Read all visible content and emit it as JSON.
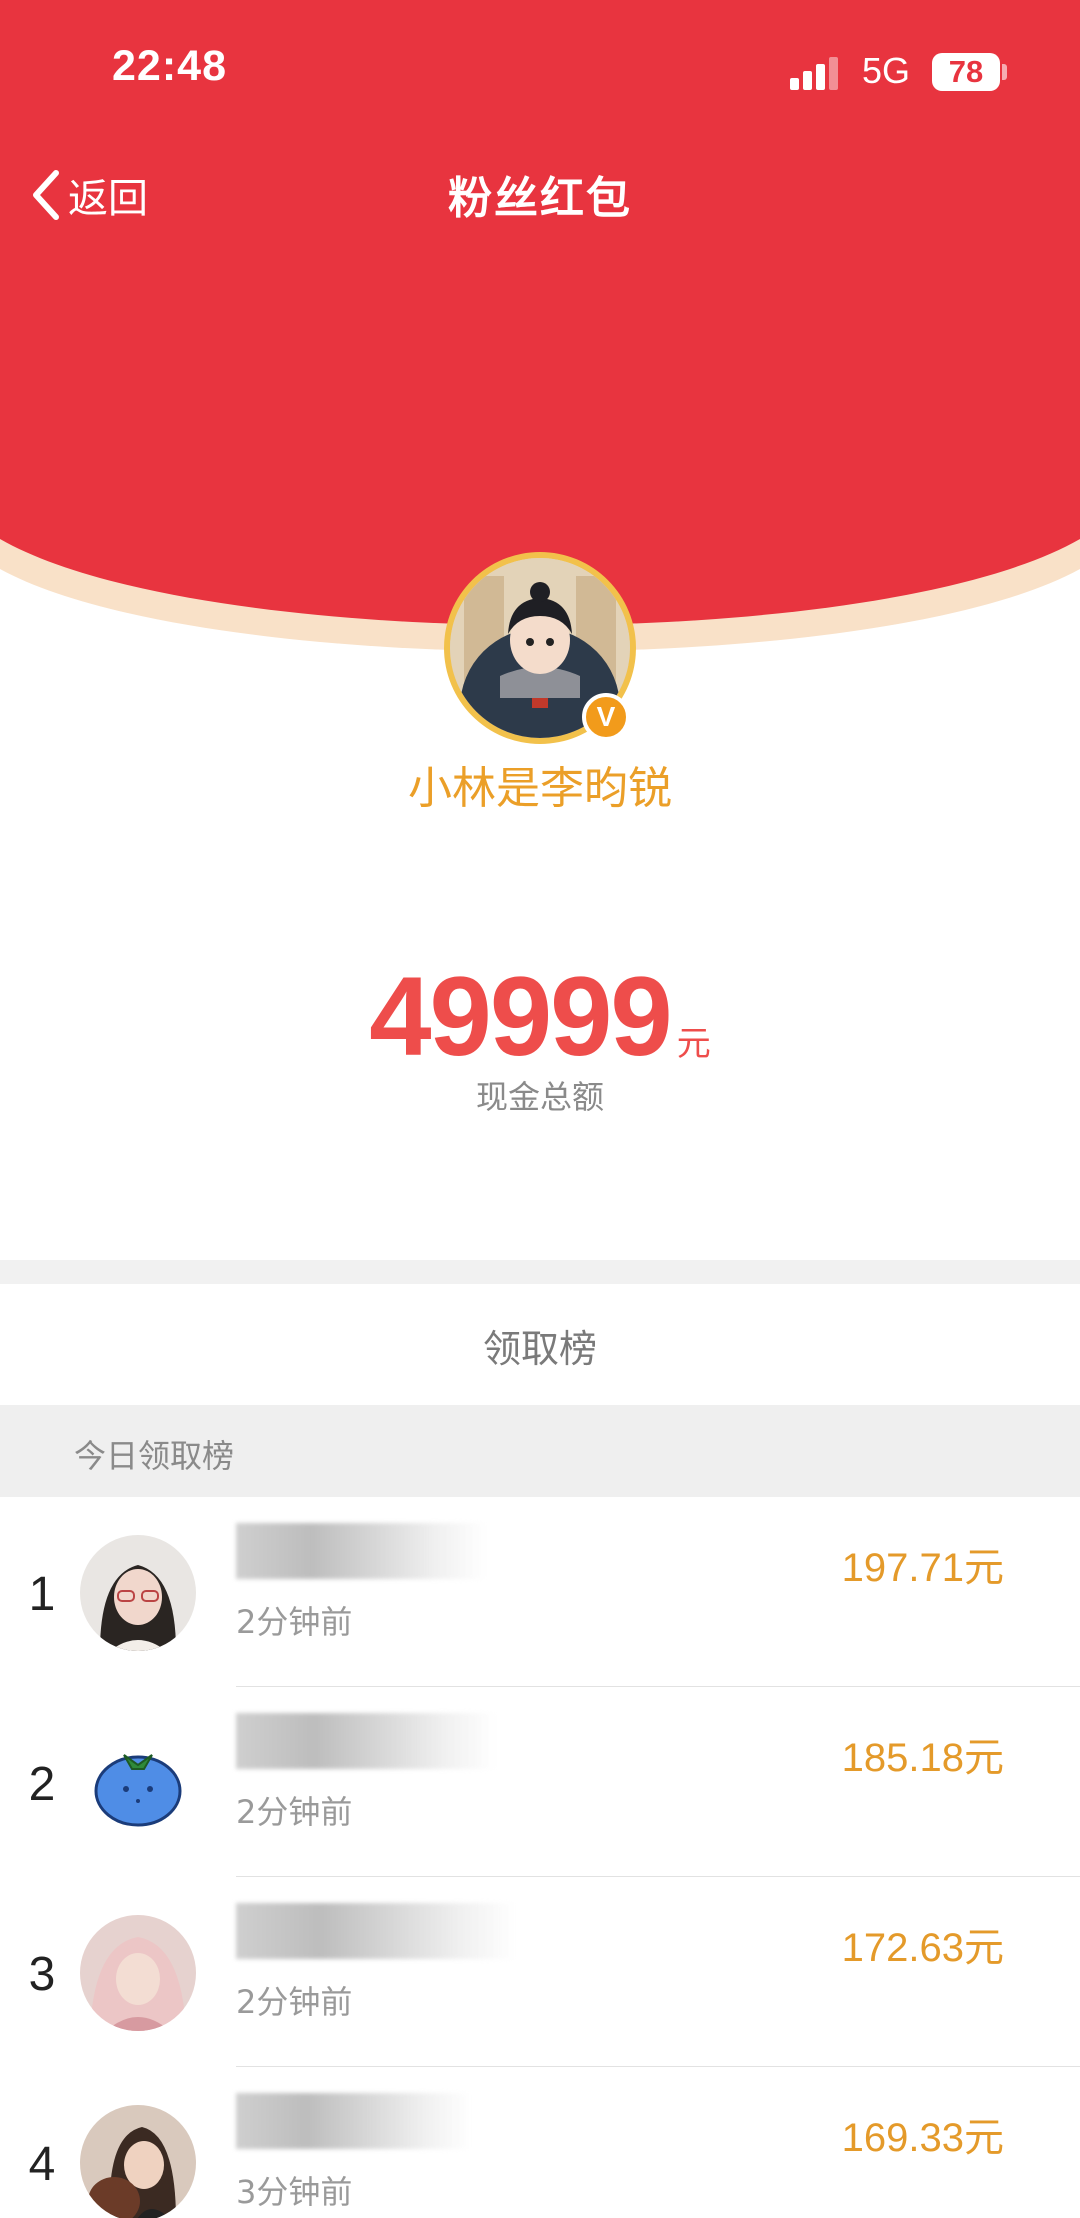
{
  "status_bar": {
    "time": "22:48",
    "network": "5G",
    "battery": "78"
  },
  "nav": {
    "back_label": "返回",
    "title": "粉丝红包"
  },
  "colors": {
    "header_red": "#e8343f",
    "accent_gold": "#eb9f28",
    "amount_red": "#ee4d4b"
  },
  "creator": {
    "name": "小林是李昀锐",
    "verified_badge": "V"
  },
  "amount": {
    "value": "49999",
    "unit": "元",
    "label": "现金总额"
  },
  "leaderboard": {
    "title": "领取榜",
    "section_label": "今日领取榜",
    "entries": [
      {
        "rank": "1",
        "name_visible": "",
        "time": "2分钟前",
        "amount": "197.71",
        "unit": "元"
      },
      {
        "rank": "2",
        "name_visible": "",
        "time": "2分钟前",
        "amount": "185.18",
        "unit": "元"
      },
      {
        "rank": "3",
        "name_visible": "",
        "time": "2分钟前",
        "amount": "172.63",
        "unit": "元"
      },
      {
        "rank": "4",
        "name_visible": "",
        "time": "3分钟前",
        "amount": "169.33",
        "unit": "元"
      }
    ]
  }
}
